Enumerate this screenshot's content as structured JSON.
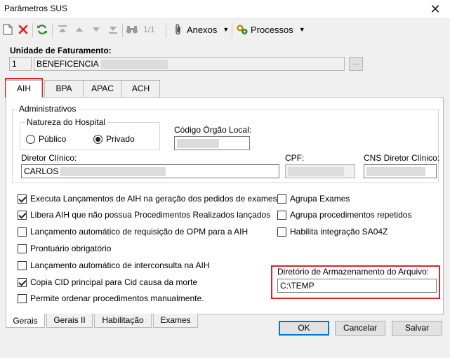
{
  "window": {
    "title": "Parâmetros SUS"
  },
  "toolbar": {
    "page_indicator": "1/1",
    "anexos_label": "Anexos",
    "processos_label": "Processos"
  },
  "unidade": {
    "label": "Unidade de Faturamento:",
    "code": "1",
    "name": "BENEFICENCIA",
    "lookup_label": "..."
  },
  "top_tabs": [
    {
      "label": "AIH"
    },
    {
      "label": "BPA"
    },
    {
      "label": "APAC"
    },
    {
      "label": "ACH"
    }
  ],
  "administrativos": {
    "title": "Administrativos",
    "natureza": {
      "title": "Natureza do Hospital",
      "option_publico": "Público",
      "option_privado": "Privado",
      "selected": "Privado"
    },
    "codigo_orgao_label": "Código Órgão Local:",
    "diretor_label": "Diretor Clínico:",
    "diretor_value": "CARLOS",
    "cpf_label": "CPF:",
    "cns_label": "CNS Diretor Clínico:"
  },
  "options": {
    "left": [
      {
        "label": "Executa Lançamentos de AIH na geração dos pedidos de exames?",
        "checked": true
      },
      {
        "label": "Libera AIH que não possua Procedimentos Realizados lançados",
        "checked": true
      },
      {
        "label": "Lançamento automático de requisição de OPM para a AIH",
        "checked": false
      },
      {
        "label": "Prontuário obrigatório",
        "checked": false
      },
      {
        "label": "Lançamento automático de interconsulta na AIH",
        "checked": false
      },
      {
        "label": "Copia CID principal para Cid causa da morte",
        "checked": true
      },
      {
        "label": "Permite ordenar procedimentos manualmente.",
        "checked": false
      }
    ],
    "right": [
      {
        "label": "Agrupa Exames",
        "checked": false
      },
      {
        "label": "Agrupa procedimentos repetidos",
        "checked": false
      },
      {
        "label": "Habilita integração SA04Z",
        "checked": false
      }
    ]
  },
  "diretorio": {
    "label": "Diretório de Armazenamento do Arquivo:",
    "value": "C:\\TEMP"
  },
  "bottom_tabs": [
    {
      "label": "Gerais"
    },
    {
      "label": "Gerais II"
    },
    {
      "label": "Habilitação"
    },
    {
      "label": "Exames"
    }
  ],
  "buttons": {
    "ok": "OK",
    "cancel": "Cancelar",
    "save": "Salvar"
  },
  "colors": {
    "highlight": "#d9242b",
    "accent": "#0078d7"
  }
}
